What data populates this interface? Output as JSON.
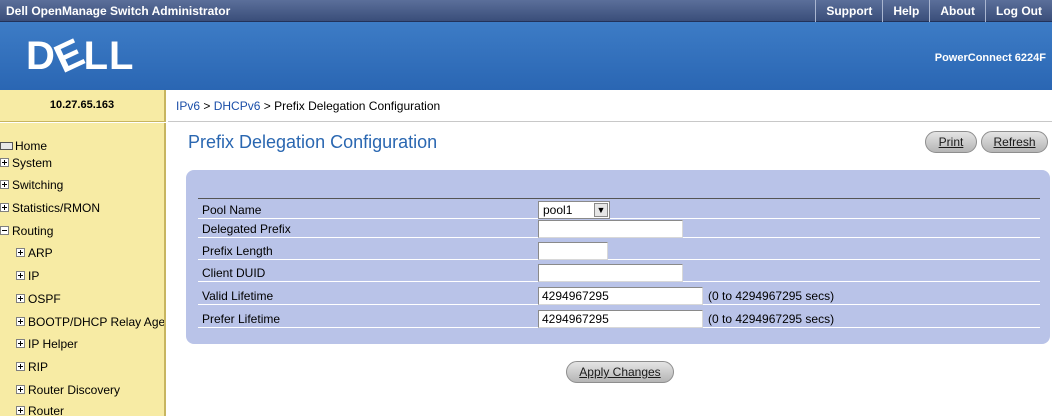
{
  "app": {
    "title": "Dell OpenManage Switch Administrator",
    "nav": [
      "Support",
      "Help",
      "About",
      "Log Out"
    ],
    "logo": {
      "d": "D",
      "e": "E",
      "ll": "LL"
    },
    "model": "PowerConnect 6224F",
    "ip": "10.27.65.163"
  },
  "breadcrumb": {
    "ipv6": "IPv6",
    "sep1": " > ",
    "dhcpv6": "DHCPv6",
    "sep2": " > ",
    "current": "Prefix Delegation Configuration"
  },
  "sidebar": {
    "home": "Home",
    "items": [
      "System",
      "Switching",
      "Statistics/RMON",
      "Routing",
      "ARP",
      "IP",
      "OSPF",
      "BOOTP/DHCP Relay Agent",
      "IP Helper",
      "RIP",
      "Router Discovery",
      "Router"
    ]
  },
  "page": {
    "title": "Prefix Delegation Configuration",
    "print": "Print",
    "refresh": "Refresh",
    "apply": "Apply Changes"
  },
  "form": {
    "pool_name": {
      "label": "Pool Name",
      "value": "pool1"
    },
    "delegated_prefix": {
      "label": "Delegated Prefix",
      "value": ""
    },
    "prefix_length": {
      "label": "Prefix Length",
      "value": ""
    },
    "client_duid": {
      "label": "Client DUID",
      "value": ""
    },
    "valid_lifetime": {
      "label": "Valid Lifetime",
      "value": "4294967295",
      "range": "(0 to 4294967295 secs)"
    },
    "prefer_lifetime": {
      "label": "Prefer Lifetime",
      "value": "4294967295",
      "range": "(0 to 4294967295 secs)"
    }
  }
}
